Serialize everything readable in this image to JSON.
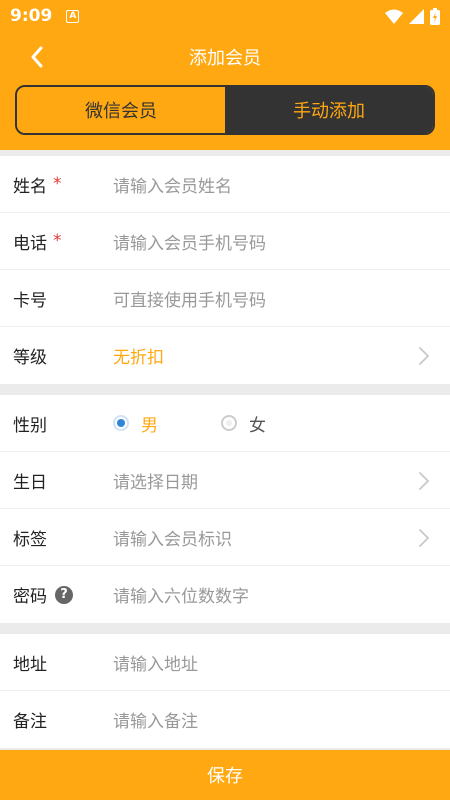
{
  "status": {
    "time": "9:09",
    "a_badge": "A"
  },
  "header": {
    "title": "添加会员"
  },
  "tabs": {
    "wechat": "微信会员",
    "manual": "手动添加",
    "active": "manual"
  },
  "form1": {
    "name": {
      "label": "姓名",
      "required": "*",
      "placeholder": "请输入会员姓名"
    },
    "phone": {
      "label": "电话",
      "required": "*",
      "placeholder": "请输入会员手机号码"
    },
    "card": {
      "label": "卡号",
      "placeholder": "可直接使用手机号码"
    },
    "level": {
      "label": "等级",
      "value": "无折扣"
    }
  },
  "form2": {
    "gender": {
      "label": "性别",
      "options": [
        "男",
        "女"
      ],
      "selected": "男"
    },
    "birthday": {
      "label": "生日",
      "placeholder": "请选择日期"
    },
    "tags": {
      "label": "标签",
      "placeholder": "请输入会员标识"
    },
    "password": {
      "label": "密码",
      "help": "?",
      "placeholder": "请输入六位数数字"
    }
  },
  "form3": {
    "address": {
      "label": "地址",
      "placeholder": "请输入地址"
    },
    "note": {
      "label": "备注",
      "placeholder": "请输入备注"
    }
  },
  "footer": {
    "save_label": "保存"
  },
  "colors": {
    "accent": "#ffa812",
    "dark": "#333333",
    "radio": "#2f86d6",
    "required": "#e53935"
  }
}
